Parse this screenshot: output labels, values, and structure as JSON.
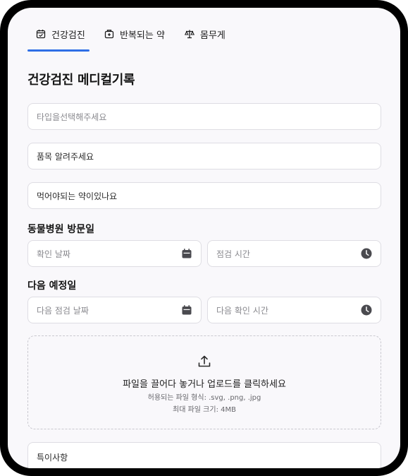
{
  "tabs": [
    {
      "label": "건강검진",
      "icon": "calendar-icon",
      "active": true
    },
    {
      "label": "반복되는 약",
      "icon": "pill-box-icon",
      "active": false
    },
    {
      "label": "몸무게",
      "icon": "scale-icon",
      "active": false
    }
  ],
  "page_title": "건강검진 메디컬기록",
  "fields": {
    "type_select": {
      "placeholder": "타입을선택해주세요"
    },
    "item": {
      "value": "품목 알려주세요"
    },
    "medicine": {
      "value": "먹어야되는 약이있나요"
    }
  },
  "visit": {
    "section_label": "동물병원 방문일",
    "date_placeholder": "확인 날짜",
    "time_placeholder": "점검 시간"
  },
  "next": {
    "section_label": "다음 예정일",
    "date_placeholder": "다음 점검 날짜",
    "time_placeholder": "다음 확인 시간"
  },
  "upload": {
    "main_text": "파일을 끌어다 놓거나 업로드를 클릭하세요",
    "allowed_formats": "허용되는 파일 형식: .svg, .png, .jpg",
    "max_size": "최대 파일 크기: 4MB"
  },
  "notes": {
    "value": "특이사항"
  },
  "colors": {
    "accent": "#2f6fe6",
    "background": "#f9f8fb",
    "border": "#dedde3",
    "icon": "#4a4a4f"
  }
}
